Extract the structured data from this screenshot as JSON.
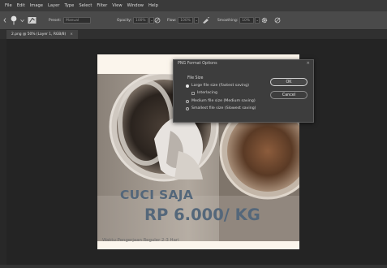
{
  "menu": [
    "File",
    "Edit",
    "Image",
    "Layer",
    "Type",
    "Select",
    "Filter",
    "View",
    "Window",
    "Help"
  ],
  "options_bar": {
    "preset_label": "Preset:",
    "preset_value": "Manual",
    "opacity_label": "Opacity:",
    "opacity_value": "100%",
    "flow_label": "Flow:",
    "flow_value": "100%",
    "smoothing_label": "Smoothing:",
    "smoothing_value": "10%"
  },
  "document_tab": {
    "label": "2.png @ 50% (Layer 1, RGB/8)",
    "close": "×"
  },
  "canvas": {
    "headline": "CUCI SAJA",
    "price": "RP 6.000/ KG",
    "footnote": "Waktu Pengerjaan Reguler 2-3 Hari"
  },
  "dialog": {
    "title": "PNG Format Options",
    "close": "×",
    "group_label": "File Size",
    "options": {
      "large": "Large file size (Fastest saving)",
      "interlacing": "Interlacing",
      "medium": "Medium file size (Medium saving)",
      "small": "Smallest file size (Slowest saving)"
    },
    "ok_label": "OK",
    "cancel_label": "Cancel",
    "selected_option": "large"
  }
}
